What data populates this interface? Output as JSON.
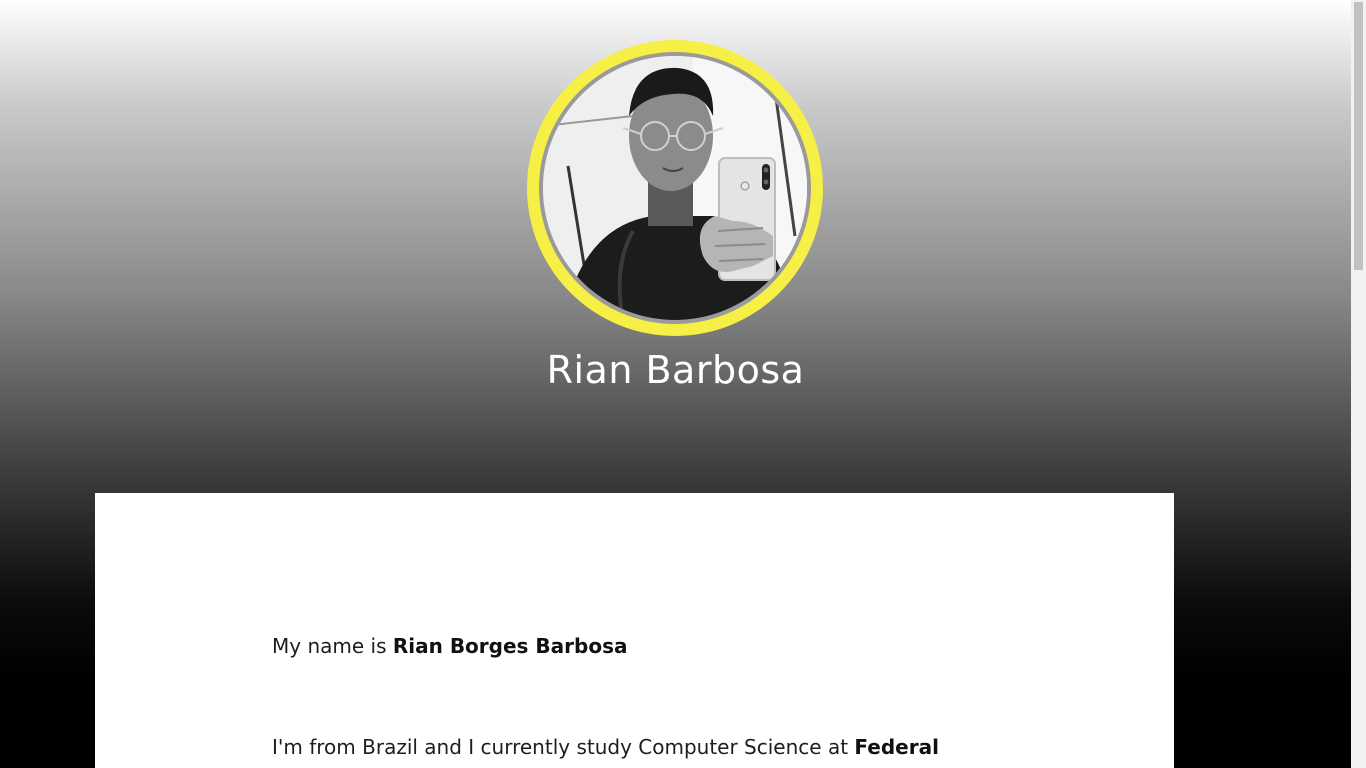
{
  "profile": {
    "name": "Rian Barbosa",
    "photo_alt": "profile-photo"
  },
  "about": {
    "intro_prefix": "My name is ",
    "intro_name": "Rian Borges Barbosa",
    "study_prefix": "I'm from Brazil and I currently study Computer Science at ",
    "study_institution_start": "Federal"
  },
  "theme": {
    "ring_color": "#f6ef45",
    "card_color": "#ffffff",
    "text_color": "#1e1e1e"
  }
}
